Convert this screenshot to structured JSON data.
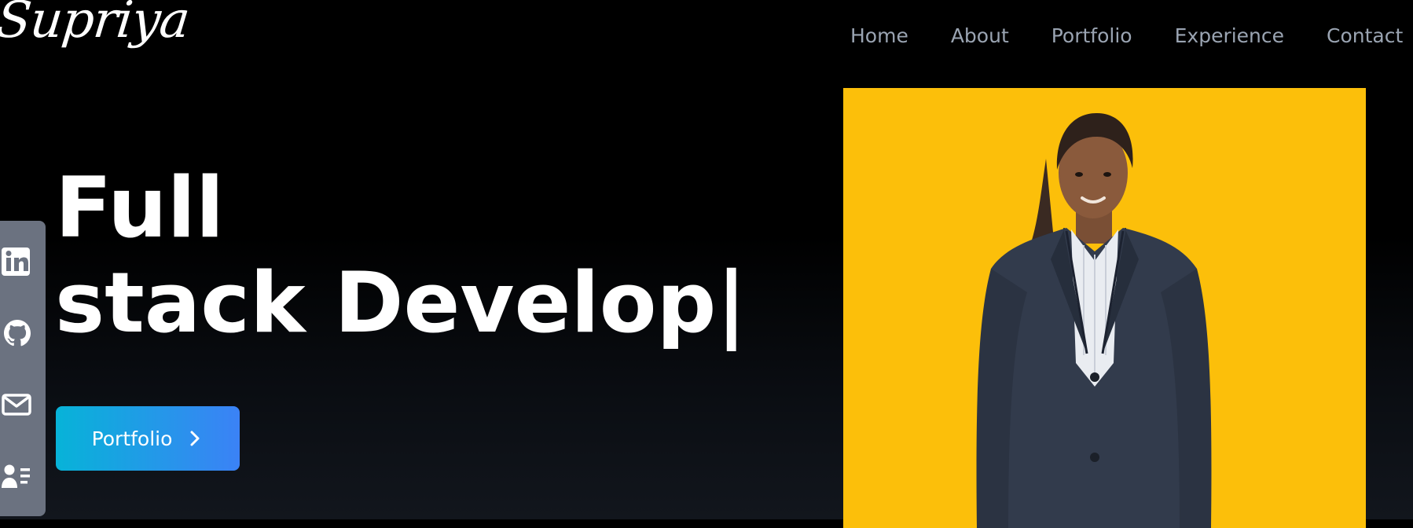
{
  "brand": {
    "name": "Supriya"
  },
  "nav": {
    "items": [
      "Home",
      "About",
      "Portfolio",
      "Experience",
      "Contact"
    ]
  },
  "hero": {
    "line1": "Full",
    "line2": "stack Develop|"
  },
  "cta": {
    "label": "Portfolio"
  },
  "social": {
    "icons": [
      "linkedin-icon",
      "github-icon",
      "mail-icon",
      "resume-icon"
    ]
  },
  "colors": {
    "accent_start": "#07b3d8",
    "accent_end": "#3b82f6",
    "photo_bg": "#fcbf0a",
    "sidebar_bg": "#6b7280",
    "nav_text": "#9aa4b2"
  }
}
